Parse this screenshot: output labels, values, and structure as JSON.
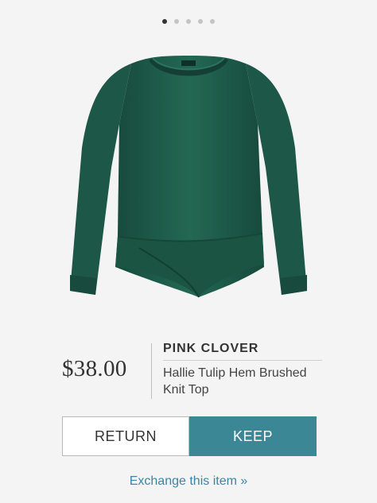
{
  "carousel": {
    "total": 5,
    "active_index": 0
  },
  "product": {
    "image_subject": "green long-sleeve knit top",
    "color": "#1f5d4b",
    "price": "$38.00",
    "brand": "PINK CLOVER",
    "name": "Hallie Tulip Hem Brushed Knit Top"
  },
  "actions": {
    "return_label": "RETURN",
    "keep_label": "KEEP",
    "keep_color": "#3c8796",
    "exchange_label": "Exchange this item »",
    "link_color": "#3b86a6"
  }
}
